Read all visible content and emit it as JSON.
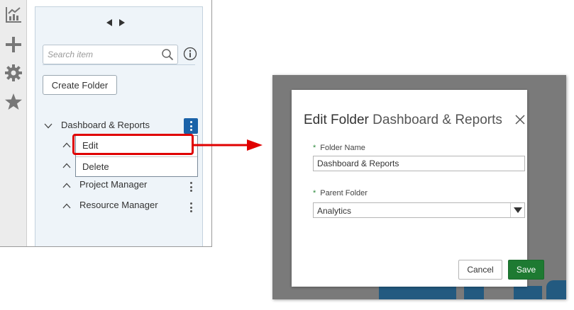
{
  "sidebar": {
    "search": {
      "placeholder": "Search item"
    },
    "create_folder_label": "Create Folder",
    "tree": [
      {
        "label": "Dashboard & Reports",
        "expanded": true
      },
      {
        "label": "Project Manager"
      },
      {
        "label": "Resource Manager"
      }
    ],
    "context_menu": [
      {
        "label": "Edit"
      },
      {
        "label": "Delete"
      }
    ]
  },
  "icons": {
    "rail": [
      "chart-icon",
      "plus-icon",
      "gear-icon",
      "star-icon"
    ]
  },
  "dialog": {
    "title": "Edit Folder",
    "subtitle": "Dashboard & Reports",
    "folder_name": {
      "label": "Folder Name",
      "value": "Dashboard & Reports"
    },
    "parent_folder": {
      "label": "Parent Folder",
      "value": "Analytics"
    },
    "required_marker": "*",
    "cancel_label": "Cancel",
    "save_label": "Save"
  },
  "colors": {
    "accent_blue": "#1a62a8",
    "highlight_red": "#e00000",
    "save_green": "#1e7a32",
    "required_green": "#2e8b3e"
  }
}
